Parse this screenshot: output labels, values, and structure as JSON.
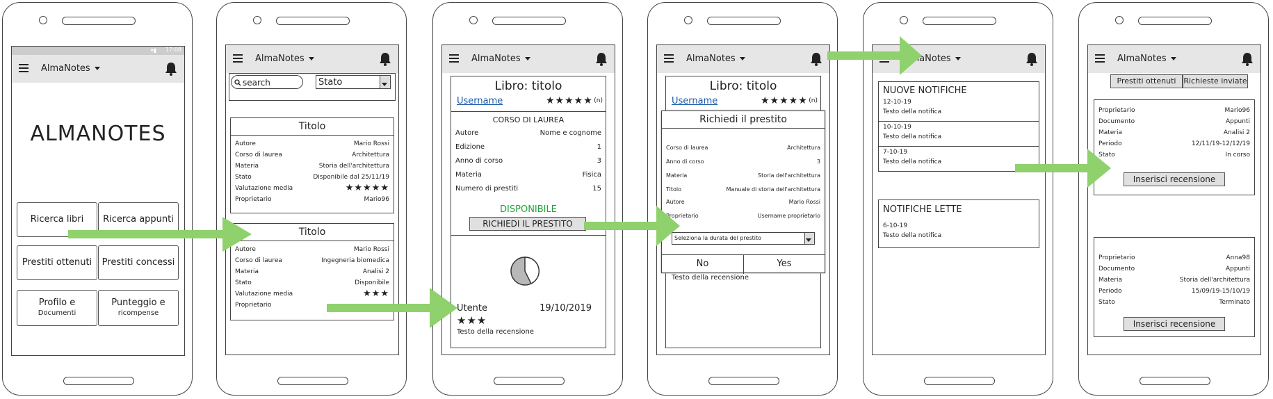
{
  "app": {
    "title": "AlmaNotes",
    "status_time": "17:08"
  },
  "phone1": {
    "logo": "ALMANOTES",
    "tiles": [
      {
        "label": "Ricerca libri",
        "sub": ""
      },
      {
        "label": "Ricerca appunti",
        "sub": ""
      },
      {
        "label": "Prestiti ottenuti",
        "sub": ""
      },
      {
        "label": "Prestiti concessi",
        "sub": ""
      },
      {
        "label": "Profilo e",
        "sub": "Documenti"
      },
      {
        "label": "Punteggio e",
        "sub": "ricompense"
      }
    ]
  },
  "phone2": {
    "search_placeholder": "search",
    "state_select": "Stato",
    "cards": [
      {
        "title": "Titolo",
        "rows": [
          {
            "k": "Autore",
            "v": "Mario Rossi"
          },
          {
            "k": "Corso di laurea",
            "v": "Architettura"
          },
          {
            "k": "Materia",
            "v": "Storia dell'architettura"
          },
          {
            "k": "Stato",
            "v": "Disponibile dal 25/11/19"
          },
          {
            "k": "Valutazione media",
            "v": "★★★★★"
          },
          {
            "k": "Proprietario",
            "v": "Mario96"
          }
        ]
      },
      {
        "title": "Titolo",
        "rows": [
          {
            "k": "Autore",
            "v": "Mario Rossi"
          },
          {
            "k": "Corso di laurea",
            "v": "Ingegneria biomedica"
          },
          {
            "k": "Materia",
            "v": "Analisi 2"
          },
          {
            "k": "Stato",
            "v": "Disponibile"
          },
          {
            "k": "Valutazione media",
            "v": "★★★"
          },
          {
            "k": "Proprietario",
            "v": ""
          }
        ]
      }
    ]
  },
  "phone3": {
    "book_title": "Libro: titolo",
    "username": "Username",
    "rating": "★★★★★",
    "rating_count": "(n)",
    "course_header": "CORSO DI LAUREA",
    "rows": [
      {
        "k": "Autore",
        "v": "Nome e cognome"
      },
      {
        "k": "Edizione",
        "v": "1"
      },
      {
        "k": "Anno di corso",
        "v": "3"
      },
      {
        "k": "Materia",
        "v": "Fisica"
      },
      {
        "k": "Numero di prestiti",
        "v": "15"
      }
    ],
    "availability": "DISPONIBILE",
    "request_button": "RICHIEDI IL PRESTITO",
    "review_user": "Utente",
    "review_date": "19/10/2019",
    "review_stars": "★★★",
    "review_text": "Testo della recensione"
  },
  "phone4": {
    "book_title": "Libro: titolo",
    "username": "Username",
    "rating": "★★★★★",
    "rating_count": "(n)",
    "dialog_title": "Richiedi il prestito",
    "rows": [
      {
        "k": "Corso di laurea",
        "v": "Architettura"
      },
      {
        "k": "Anno di corso",
        "v": "3"
      },
      {
        "k": "Materia",
        "v": "Storia dell'architettura"
      },
      {
        "k": "Titolo",
        "v": "Manuale di storia dell'architettura"
      },
      {
        "k": "Autore",
        "v": "Mario Rossi"
      },
      {
        "k": "Proprietario",
        "v": "Username proprietario"
      }
    ],
    "duration_select": "Seleziona la durata del prestito",
    "no_button": "No",
    "yes_button": "Yes",
    "review_text": "Testo della recensione"
  },
  "phone5": {
    "new_header": "NUOVE NOTIFICHE",
    "new_items": [
      {
        "date": "12-10-19",
        "text": "Testo della notifica"
      },
      {
        "date": "10-10-19",
        "text": "Testo della notifica"
      },
      {
        "date": "7-10-19",
        "text": "Testo della notifica"
      }
    ],
    "read_header": "NOTIFICHE LETTE",
    "read_items": [
      {
        "date": "6-10-19",
        "text": "Testo della notifica"
      }
    ]
  },
  "phone6": {
    "tab_obtained": "Prestiti ottenuti",
    "tab_requests": "Richieste inviate",
    "loans": [
      {
        "rows": [
          {
            "k": "Proprietario",
            "v": "Mario96"
          },
          {
            "k": "Documento",
            "v": "Appunti"
          },
          {
            "k": "Materia",
            "v": "Analisi 2"
          },
          {
            "k": "Periodo",
            "v": "12/11/19-12/12/19"
          },
          {
            "k": "Stato",
            "v": "In corso"
          }
        ],
        "button": "Inserisci recensione"
      },
      {
        "rows": [
          {
            "k": "Proprietario",
            "v": "Anna98"
          },
          {
            "k": "Documento",
            "v": "Appunti"
          },
          {
            "k": "Materia",
            "v": "Storia dell'architettura"
          },
          {
            "k": "Periodo",
            "v": "15/09/19-15/10/19"
          },
          {
            "k": "Stato",
            "v": "Terminato"
          }
        ],
        "button": "Inserisci recensione"
      }
    ]
  },
  "colors": {
    "arrow": "#8fd16c",
    "header_bg": "#e6e6e6",
    "available": "#22a33a"
  },
  "icons": [
    "menu-icon",
    "bell-icon",
    "search-icon",
    "chevron-down-icon",
    "pie-chart-icon",
    "wifi-icon",
    "battery-icon"
  ]
}
